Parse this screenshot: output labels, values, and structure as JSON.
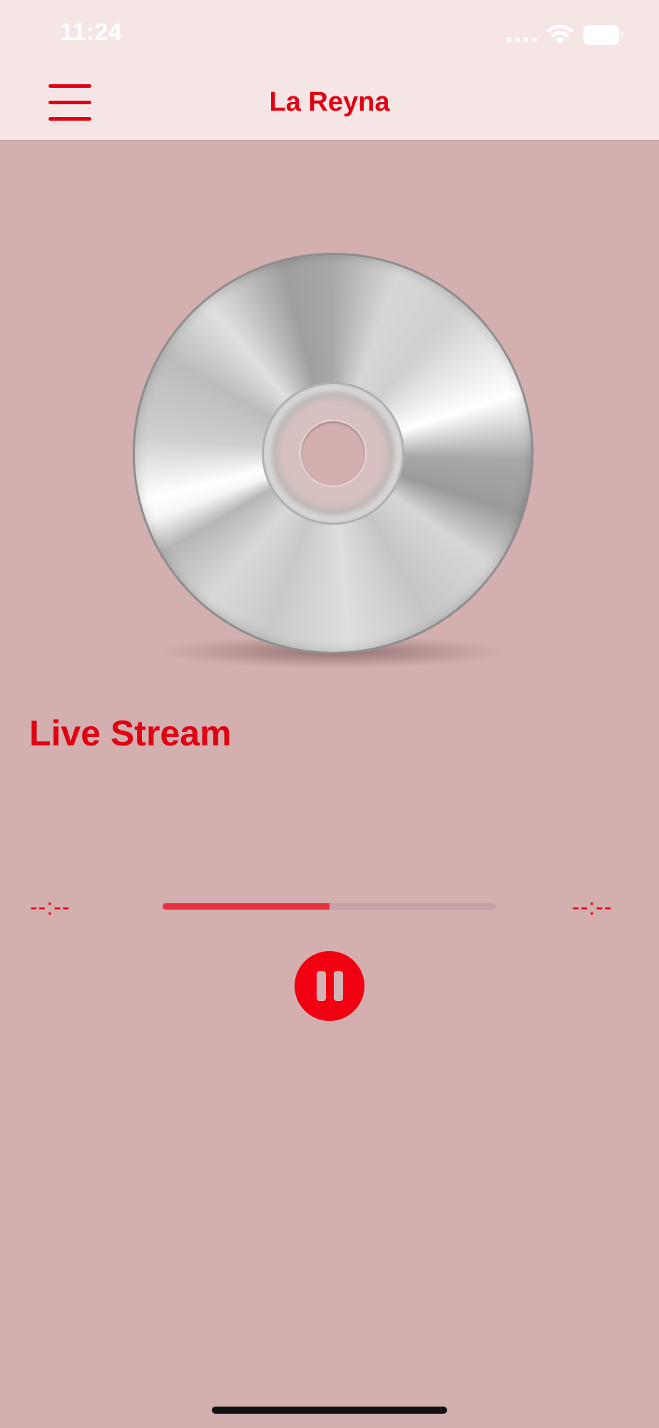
{
  "status_bar": {
    "time": "11:24",
    "icons": [
      "signal-dots-icon",
      "wifi-icon",
      "battery-icon"
    ]
  },
  "nav_bar": {
    "menu_icon": "hamburger-menu-icon",
    "title": "La Reyna"
  },
  "album_art": {
    "icon": "compact-disc-icon"
  },
  "player": {
    "stream_title": "Live Stream",
    "elapsed_time": "--:--",
    "remaining_time": "--:--",
    "progress_percent": 50,
    "pause_icon": "pause-icon"
  },
  "colors": {
    "accent": "#e00012",
    "background": "#d3afaf",
    "nav_background": "#f5e5e5",
    "progress_fill": "#e9313f",
    "progress_track": "#c4a2a6"
  }
}
